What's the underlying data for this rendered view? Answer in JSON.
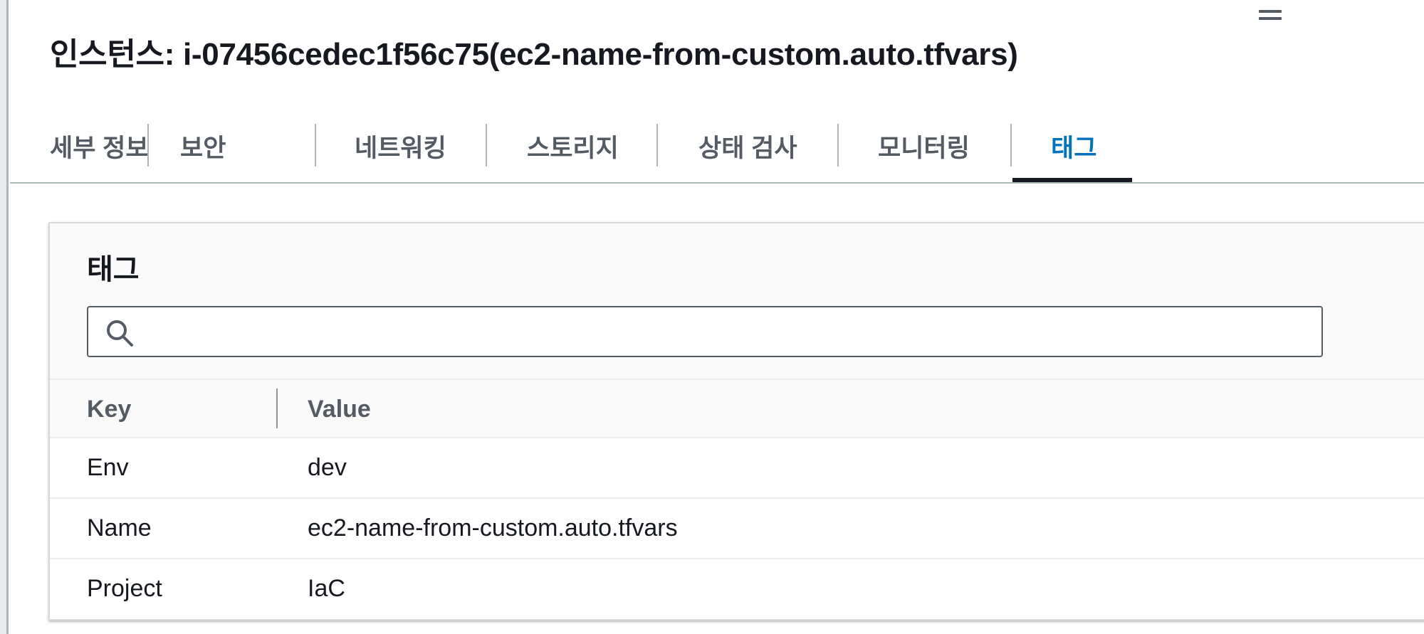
{
  "page": {
    "title": "인스턴스: i-07456cedec1f56c75(ec2-name-from-custom.auto.tfvars)"
  },
  "tabs": [
    {
      "label": "세부 정보",
      "active": false
    },
    {
      "label": "보안",
      "active": false
    },
    {
      "label": "네트워킹",
      "active": false
    },
    {
      "label": "스토리지",
      "active": false
    },
    {
      "label": "상태 검사",
      "active": false
    },
    {
      "label": "모니터링",
      "active": false
    },
    {
      "label": "태그",
      "active": true
    }
  ],
  "tags_panel": {
    "title": "태그",
    "search": {
      "value": "",
      "placeholder": ""
    },
    "columns": [
      "Key",
      "Value"
    ],
    "rows": [
      {
        "key": "Env",
        "value": "dev"
      },
      {
        "key": "Name",
        "value": "ec2-name-from-custom.auto.tfvars"
      },
      {
        "key": "Project",
        "value": "IaC"
      }
    ]
  },
  "icons": {
    "search": "search-icon",
    "panel_toggle": "drag-handle-icon"
  },
  "colors": {
    "accent": "#0073bb",
    "text": "#16191f",
    "muted_text": "#545b64",
    "border": "#aab7b8",
    "header_bg": "#fafafa"
  }
}
